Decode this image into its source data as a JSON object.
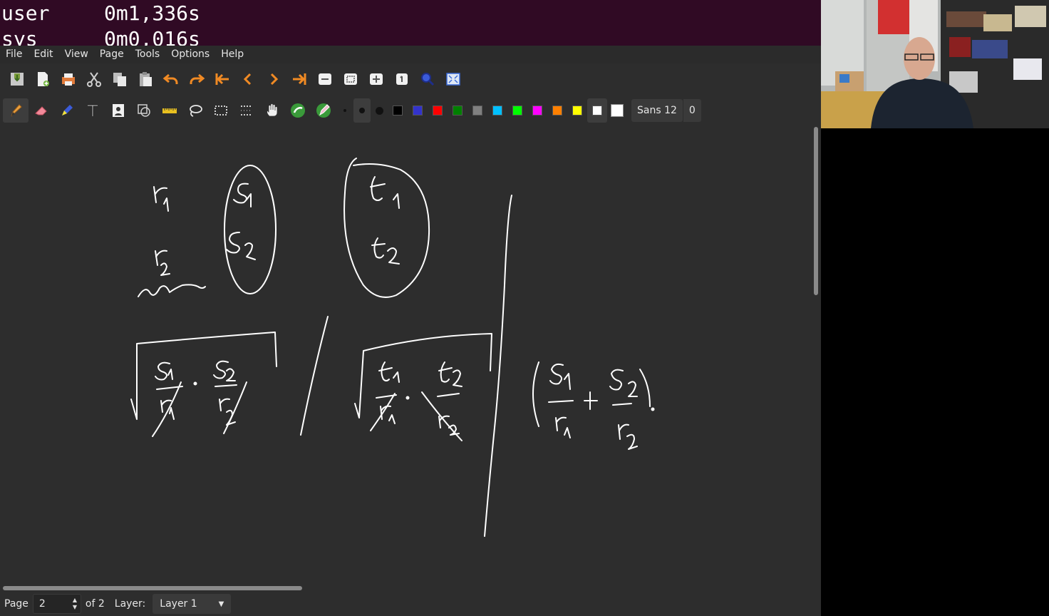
{
  "terminal": {
    "lines": [
      {
        "label": "user",
        "value": "0m1,336s"
      },
      {
        "label": "sys",
        "value": "0m0,016s"
      }
    ]
  },
  "menubar": {
    "items": [
      "File",
      "Edit",
      "View",
      "Page",
      "Tools",
      "Options",
      "Help"
    ]
  },
  "toolbar1": {
    "icons": [
      "save-icon",
      "new-page-icon",
      "print-icon",
      "cut-icon",
      "copy-icon",
      "paste-icon",
      "undo-icon",
      "redo-icon",
      "first-page-icon",
      "previous-page-icon",
      "next-page-icon",
      "last-page-icon",
      "zoom-out-icon",
      "zoom-fit-icon",
      "zoom-in-icon",
      "zoom-100-icon",
      "zoom-custom-icon",
      "fullscreen-icon"
    ]
  },
  "toolbar2": {
    "tools": [
      "pen-icon",
      "eraser-icon",
      "highlighter-icon",
      "text-icon",
      "image-icon",
      "shape-recognizer-icon",
      "ruler-icon",
      "select-region-icon",
      "select-rectangle-icon",
      "vertical-space-icon",
      "hand-icon",
      "default-tool-icon",
      "tool-settings-icon"
    ],
    "sizes": [
      "fine",
      "medium",
      "thick"
    ],
    "colors": [
      "#000000",
      "#3333cc",
      "#ff0000",
      "#008000",
      "#808080",
      "#00c0ff",
      "#00ff00",
      "#ff00ff",
      "#ff8000",
      "#ffff00",
      "#ffffff"
    ],
    "current_color": "#ffffff",
    "font": "Sans 12",
    "line_width": "0"
  },
  "statusbar": {
    "page_label": "Page",
    "page_value": "2",
    "of_label": "of 2",
    "layer_label": "Layer:",
    "layer_value": "Layer 1"
  },
  "canvas": {
    "handwriting": [
      "r1",
      "r2",
      "s1",
      "s2",
      "t1",
      "t2",
      "s1/r1 · s2/r2",
      "t1/r1 · t2/r2",
      "(s1/r1 + s2/r2)"
    ]
  }
}
